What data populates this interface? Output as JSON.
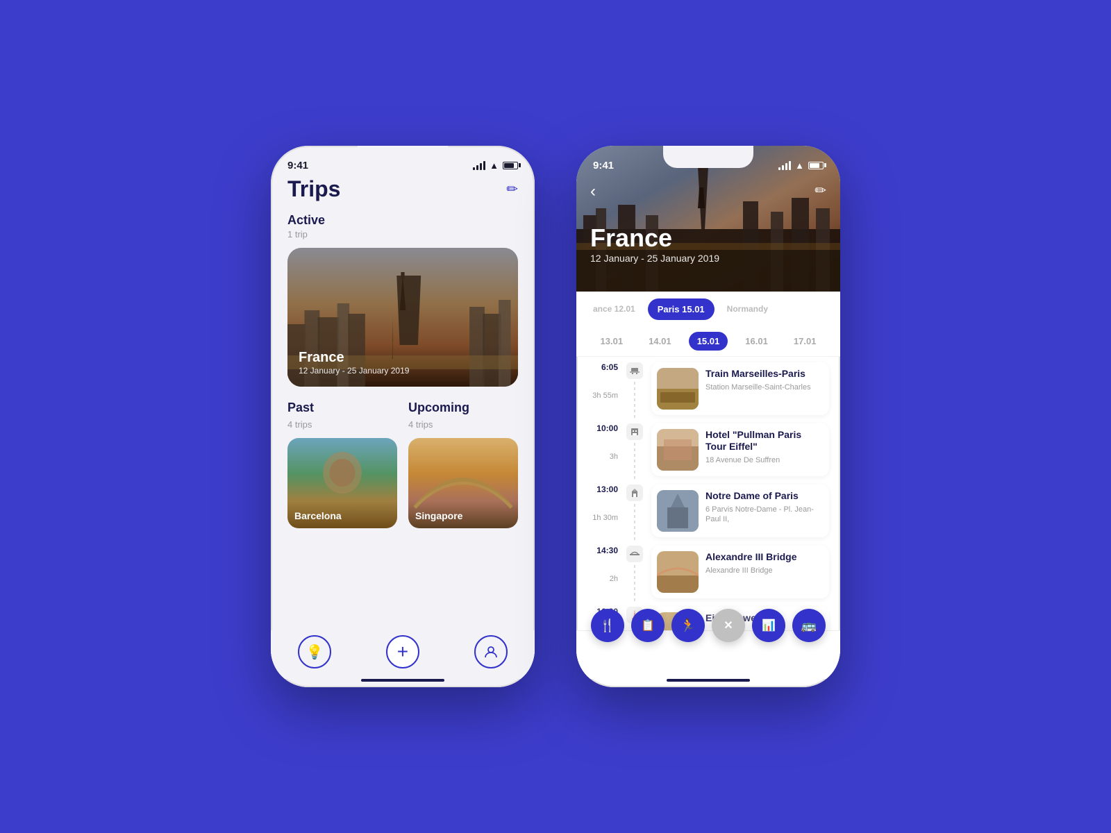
{
  "background": "#3d3dcc",
  "phone1": {
    "statusBar": {
      "time": "9:41"
    },
    "header": {
      "title": "Trips",
      "editIcon": "✏"
    },
    "activeSection": {
      "label": "Active",
      "count": "1 trip"
    },
    "activeTrip": {
      "city": "France",
      "dates": "12 January - 25 January 2019"
    },
    "pastSection": {
      "label": "Past",
      "count": "4 trips"
    },
    "upcomingSection": {
      "label": "Upcoming",
      "count": "4 trips"
    },
    "pastTrips": [
      {
        "city": "Barcelona"
      }
    ],
    "upcomingTrips": [
      {
        "city": "Singapore"
      }
    ],
    "nav": [
      {
        "icon": "💡",
        "name": "discover"
      },
      {
        "icon": "+",
        "name": "add"
      },
      {
        "icon": "👤",
        "name": "profile"
      }
    ]
  },
  "phone2": {
    "statusBar": {
      "time": "9:41"
    },
    "hero": {
      "city": "France",
      "dates": "12 January - 25 January 2019"
    },
    "locationTabs": [
      {
        "label": "ance 12.01",
        "active": false
      },
      {
        "label": "Paris 15.01",
        "active": true
      },
      {
        "label": "Normandy",
        "active": false
      }
    ],
    "datePills": [
      {
        "date": "13.01",
        "active": false
      },
      {
        "date": "14.01",
        "active": false
      },
      {
        "date": "15.01",
        "active": true
      },
      {
        "date": "16.01",
        "active": false
      },
      {
        "date": "17.01",
        "active": false
      }
    ],
    "scheduleItems": [
      {
        "time": "6:05",
        "duration": "3h 55m",
        "icon": "🚂",
        "name": "Train Marseilles-Paris",
        "address": "Station Marseille-Saint-Charles",
        "thumbType": "train"
      },
      {
        "time": "10:00",
        "duration": "3h",
        "icon": "🏨",
        "name": "Hotel \"Pullman Paris Tour Eiffel\"",
        "address": "18 Avenue De Suffren",
        "thumbType": "hotel"
      },
      {
        "time": "13:00",
        "duration": "1h 30m",
        "icon": "🏛",
        "name": "Notre Dame of Paris",
        "address": "6 Parvis Notre-Dame - Pl. Jean-Paul II,",
        "thumbType": "notre"
      },
      {
        "time": "14:30",
        "duration": "2h",
        "icon": "🌉",
        "name": "Alexandre III Bridge",
        "address": "Alexandre III Bridge",
        "thumbType": "bridge"
      },
      {
        "time": "16:30",
        "duration": "",
        "icon": "🗼",
        "name": "Eiffel Tower",
        "address": "",
        "thumbType": "bridge"
      }
    ],
    "fabs": [
      {
        "icon": "🍴",
        "color": "blue",
        "name": "add-restaurant"
      },
      {
        "icon": "📋",
        "color": "blue",
        "name": "add-note"
      },
      {
        "icon": "🏃",
        "color": "blue",
        "name": "add-activity"
      },
      {
        "icon": "✕",
        "color": "close",
        "name": "close-fab"
      },
      {
        "icon": "📊",
        "color": "blue",
        "name": "add-schedule"
      },
      {
        "icon": "🚌",
        "color": "blue",
        "name": "add-transport"
      }
    ]
  }
}
